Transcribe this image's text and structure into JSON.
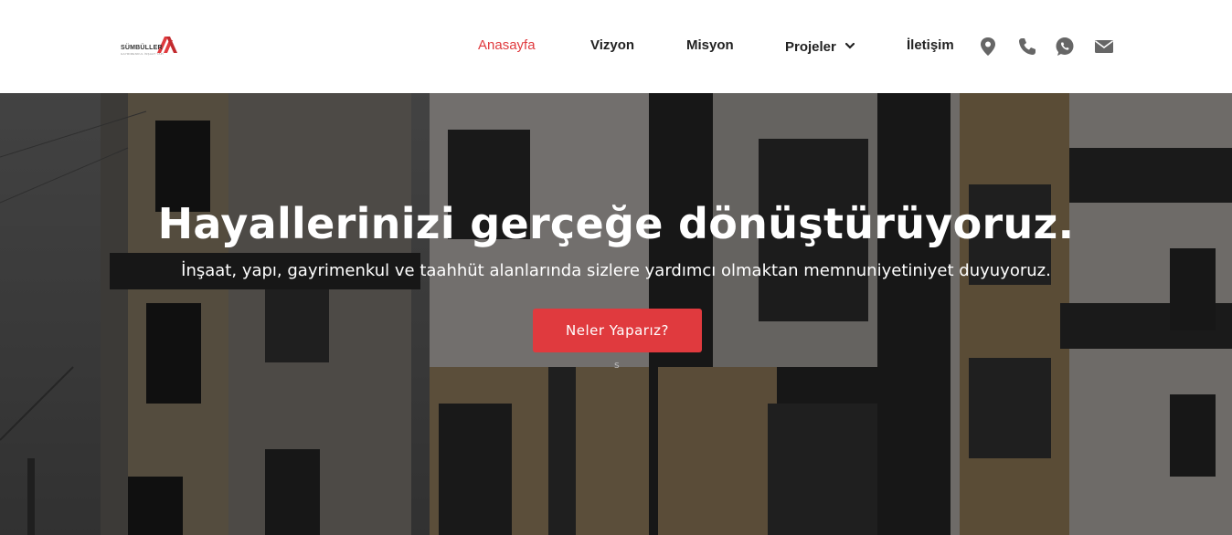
{
  "brand": {
    "name": "SÜMBÜLLER",
    "tagline": "GAYRIMENKUL İNŞAAT YAPI",
    "accent_color": "#e03a3e"
  },
  "nav": {
    "items": [
      {
        "label": "Anasayfa",
        "active": true
      },
      {
        "label": "Vizyon"
      },
      {
        "label": "Misyon"
      },
      {
        "label": "Projeler",
        "has_dropdown": true
      },
      {
        "label": "İletişim"
      }
    ],
    "icons": [
      "location-pin-icon",
      "phone-icon",
      "whatsapp-icon",
      "envelope-icon"
    ]
  },
  "hero": {
    "title": "Hayallerinizi gerçeğe dönüştürüyoruz.",
    "subtitle": "İnşaat, yapı, gayrimenkul ve taahhüt alanlarında sizlere yardımcı olmaktan memnuniyetiniyet duyuyoruz.",
    "button_label": "Neler Yaparız?",
    "stray_text": "s"
  }
}
